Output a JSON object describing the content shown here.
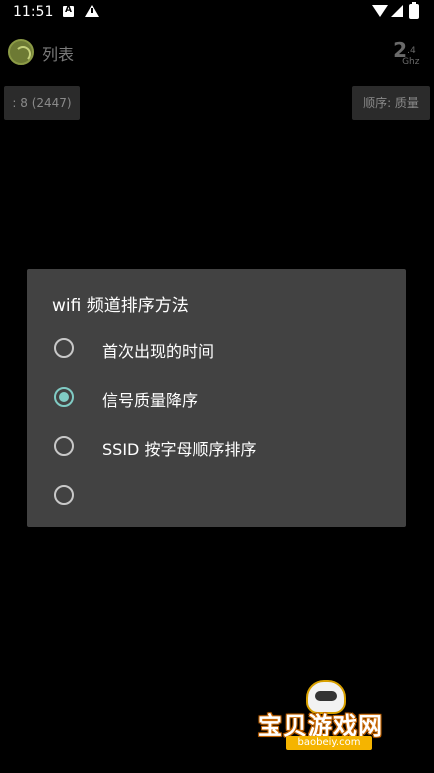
{
  "status_bar": {
    "time": "11:51",
    "icons": [
      "a-notification-icon",
      "warning-icon",
      "wifi-icon",
      "signal-icon",
      "battery-icon"
    ]
  },
  "app_bar": {
    "title": "列表",
    "band_main": "2",
    "band_sup": ".4",
    "band_unit": "Ghz"
  },
  "toolbar": {
    "count_label": ": 8 (2447)",
    "order_label": "顺序: 质量"
  },
  "dialog": {
    "title": "wifi 频道排序方法",
    "options": [
      {
        "label": "首次出现的时间",
        "checked": false
      },
      {
        "label": "信号质量降序",
        "checked": true
      },
      {
        "label": "SSID 按字母顺序排序",
        "checked": false
      },
      {
        "label": "",
        "checked": false
      }
    ],
    "accent_color": "#80cbc4"
  },
  "watermark": {
    "text": "宝贝游戏网",
    "url": "baobeiy.com"
  }
}
